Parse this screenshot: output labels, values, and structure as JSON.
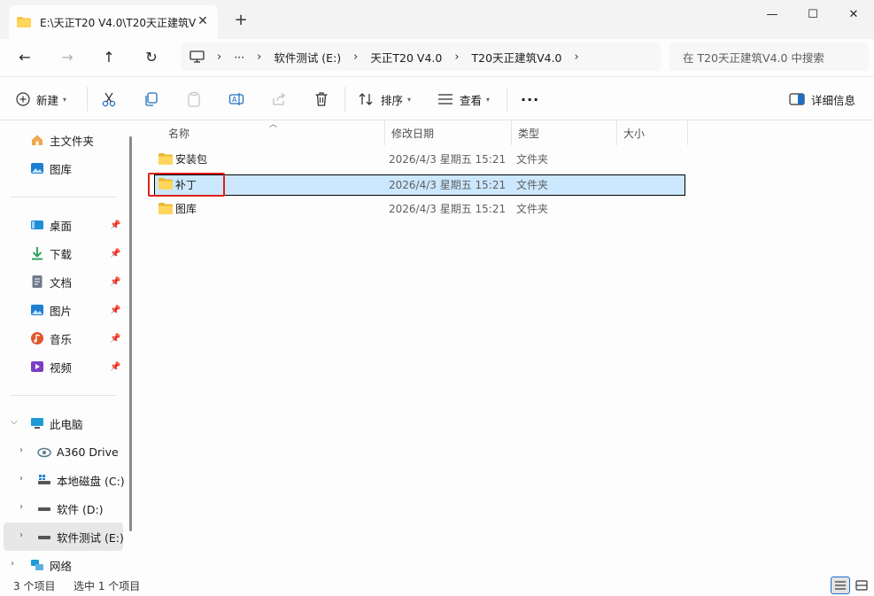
{
  "window": {
    "tab_title": "E:\\天正T20 V4.0\\T20天正建筑V",
    "tab_close": "✕",
    "new_tab": "+",
    "controls": {
      "minimize": "—",
      "maximize": "☐",
      "close": "✕"
    }
  },
  "nav": {
    "back": "←",
    "forward": "→",
    "up": "↑",
    "refresh": "↻",
    "breadcrumb": {
      "more": "···",
      "items": [
        "软件测试 (E:)",
        "天正T20 V4.0",
        "T20天正建筑V4.0"
      ]
    },
    "search_placeholder": "在 T20天正建筑V4.0 中搜索"
  },
  "toolbar": {
    "new_label": "新建",
    "sort_label": "排序",
    "view_label": "查看",
    "more": "···",
    "details_label": "详细信息"
  },
  "sidebar": {
    "quick": [
      {
        "label": "主文件夹",
        "icon": "home-icon"
      },
      {
        "label": "图库",
        "icon": "gallery-icon"
      }
    ],
    "pinned": [
      {
        "label": "桌面",
        "icon": "desktop-icon",
        "color": "#1f8fd6"
      },
      {
        "label": "下载",
        "icon": "download-icon",
        "color": "#1f9b55"
      },
      {
        "label": "文档",
        "icon": "document-icon",
        "color": "#6e7a8a"
      },
      {
        "label": "图片",
        "icon": "pictures-icon",
        "color": "#1e7fd0"
      },
      {
        "label": "音乐",
        "icon": "music-icon",
        "color": "#e2562c"
      },
      {
        "label": "视频",
        "icon": "video-icon",
        "color": "#7a3fc5"
      }
    ],
    "this_pc": "此电脑",
    "drives": [
      {
        "label": "A360 Drive",
        "icon": "cloud-drive-icon"
      },
      {
        "label": "本地磁盘 (C:)",
        "icon": "system-drive-icon"
      },
      {
        "label": "软件 (D:)",
        "icon": "drive-icon"
      },
      {
        "label": "软件测试 (E:)",
        "icon": "drive-icon",
        "selected": true
      }
    ],
    "network": "网络"
  },
  "columns": {
    "name": "名称",
    "date": "修改日期",
    "type": "类型",
    "size": "大小"
  },
  "files": [
    {
      "name": "安装包",
      "date": "2026/4/3 星期五 15:21",
      "type": "文件夹",
      "selected": false
    },
    {
      "name": "补丁",
      "date": "2026/4/3 星期五 15:21",
      "type": "文件夹",
      "selected": true
    },
    {
      "name": "图库",
      "date": "2026/4/3 星期五 15:21",
      "type": "文件夹",
      "selected": false
    }
  ],
  "status": {
    "item_count": "3 个项目",
    "selection": "选中 1 个项目"
  },
  "colors": {
    "accent_selection": "#cce8ff",
    "highlight_red": "#e0201a",
    "folder_yellow": "#f4c542"
  }
}
